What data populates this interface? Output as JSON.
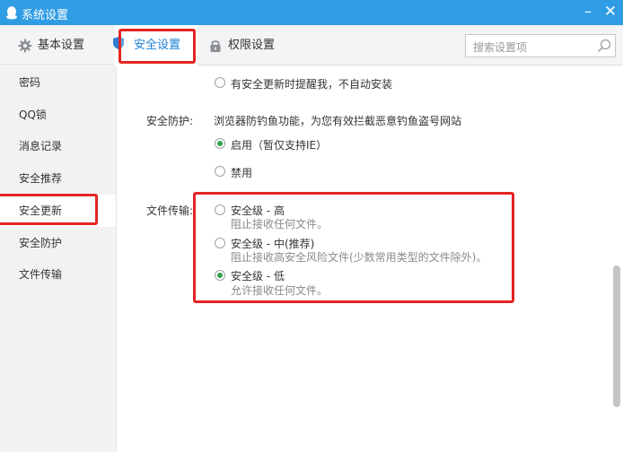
{
  "window": {
    "title": "系统设置",
    "minimize_glyph": "–",
    "close_glyph": "✕",
    "title_bar_color": "#2f9ce3"
  },
  "tabs": [
    {
      "label": "基本设置",
      "icon": "gear-icon"
    },
    {
      "label": "安全设置",
      "icon": "shield-icon",
      "active": true
    },
    {
      "label": "权限设置",
      "icon": "lock-icon"
    }
  ],
  "search": {
    "placeholder": "搜索设置项",
    "icon": "search-icon"
  },
  "sidebar": {
    "items": [
      {
        "label": "密码"
      },
      {
        "label": "QQ锁"
      },
      {
        "label": "消息记录"
      },
      {
        "label": "安全推荐"
      },
      {
        "label": "安全更新",
        "active": true
      },
      {
        "label": "安全防护"
      },
      {
        "label": "文件传输"
      }
    ]
  },
  "main": {
    "update_option": {
      "label": "有安全更新时提醒我，不自动安装",
      "checked": false
    },
    "protection": {
      "label": "安全防护:",
      "description": "浏览器防钓鱼功能，为您有效拦截恶意钓鱼盗号网站",
      "options": [
        {
          "label": "启用（暂仅支持IE）",
          "checked": true
        },
        {
          "label": "禁用",
          "checked": false
        }
      ]
    },
    "file_transfer": {
      "label": "文件传输:",
      "options": [
        {
          "label": "安全级 - 高",
          "desc": "阻止接收任何文件。",
          "checked": false
        },
        {
          "label": "安全级 - 中(推荐)",
          "desc": "阻止接收高安全风险文件(少数常用类型的文件除外)。",
          "checked": false
        },
        {
          "label": "安全级 - 低",
          "desc": "允许接收任何文件。",
          "checked": true
        }
      ]
    }
  },
  "colors": {
    "accent": "#1a82d6",
    "highlight": "#e42424",
    "radio_on": "#33a24c"
  }
}
